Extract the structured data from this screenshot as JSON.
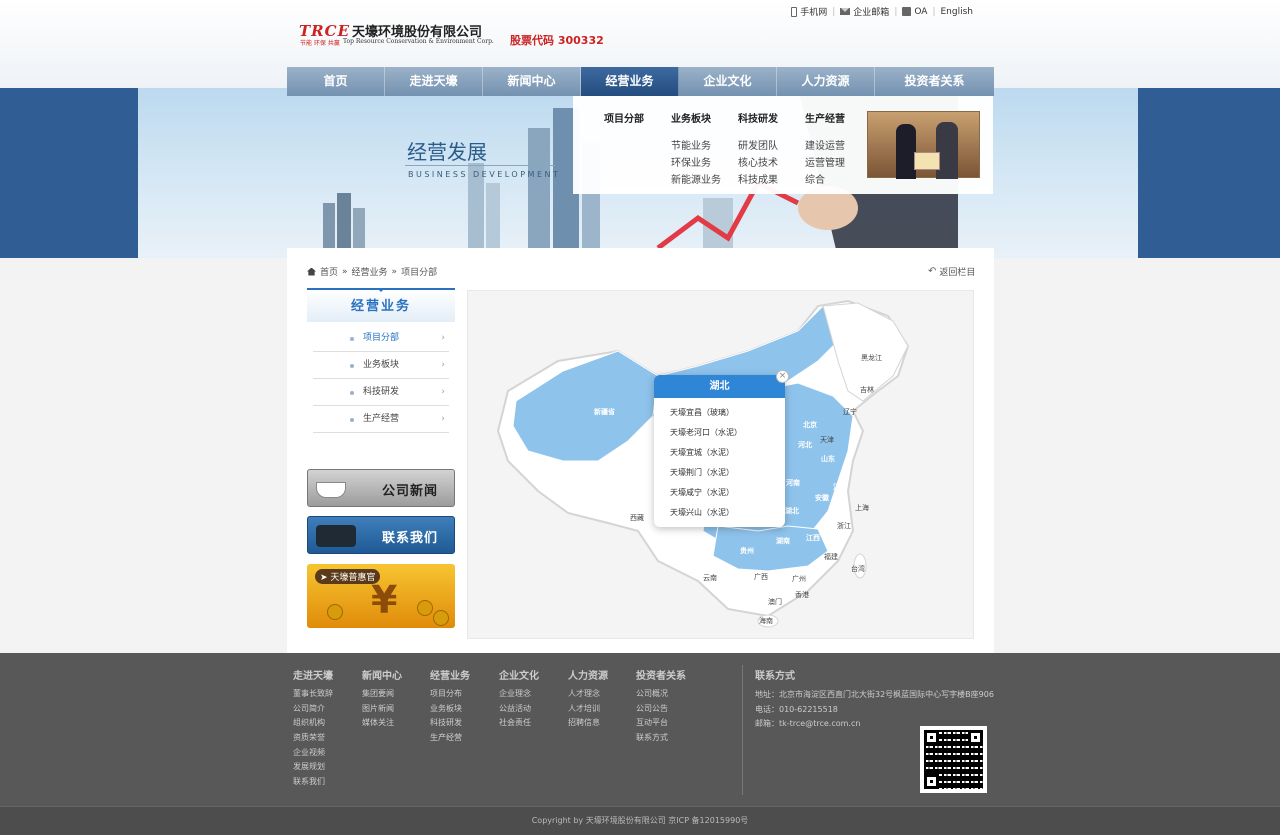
{
  "header": {
    "logo_mark": "TRCE",
    "company_name": "天壕环境股份有限公司",
    "slogan": "节能  环保  共赢",
    "english_name": "Top Resource Conservation & Environment Corp.",
    "stock_code": "股票代码 300332",
    "top_links": [
      "手机网",
      "企业邮箱",
      "OA",
      "English"
    ]
  },
  "nav": {
    "items": [
      "首页",
      "走进天壕",
      "新闻中心",
      "经营业务",
      "企业文化",
      "人力资源",
      "投资者关系"
    ],
    "active_index": 3
  },
  "dropdown": {
    "columns": [
      {
        "heading": "项目分部",
        "links": []
      },
      {
        "heading": "业务板块",
        "links": [
          "节能业务",
          "环保业务",
          "新能源业务"
        ]
      },
      {
        "heading": "科技研发",
        "links": [
          "研发团队",
          "核心技术",
          "科技成果"
        ]
      },
      {
        "heading": "生产经营",
        "links": [
          "建设运营",
          "运营管理",
          "综合"
        ]
      }
    ]
  },
  "banner": {
    "title": "经营发展",
    "subtitle": "BUSINESS DEVELOPMENT"
  },
  "breadcrumb": {
    "items": [
      "首页",
      "经营业务",
      "项目分部"
    ],
    "back": "返回栏目"
  },
  "sidebar": {
    "title": "经营业务",
    "items": [
      "项目分部",
      "业务板块",
      "科技研发",
      "生产经营"
    ],
    "active_index": 0
  },
  "promos": {
    "news": "公司新闻",
    "contact": "联系我们",
    "gift": "天壕普惠官"
  },
  "map": {
    "provinces_labels": [
      "新疆省",
      "西藏",
      "黑龙江",
      "吉林",
      "辽宁",
      "北京",
      "天津",
      "河北",
      "山东",
      "河南",
      "江苏",
      "安徽",
      "上海",
      "浙江",
      "湖北",
      "湖南",
      "江西",
      "贵州",
      "福建",
      "云南",
      "广西",
      "广州",
      "台湾",
      "香港",
      "澳门",
      "海南"
    ],
    "popup": {
      "title": "湖北",
      "items": [
        "天壕宜昌（玻璃）",
        "天壕老河口（水泥）",
        "天壕宜城（水泥）",
        "天壕荆门（水泥）",
        "天壕咸宁（水泥）",
        "天壕兴山（水泥）"
      ]
    },
    "highlight_color": "#8ec3ec",
    "base_color": "#ffffff"
  },
  "footer": {
    "columns": [
      {
        "heading": "走进天壕",
        "links": [
          "董事长致辞",
          "公司简介",
          "组织机构",
          "资质荣誉",
          "企业视频",
          "发展规划",
          "联系我们"
        ]
      },
      {
        "heading": "新闻中心",
        "links": [
          "集团要闻",
          "图片新闻",
          "媒体关注"
        ]
      },
      {
        "heading": "经营业务",
        "links": [
          "项目分布",
          "业务板块",
          "科技研发",
          "生产经营"
        ]
      },
      {
        "heading": "企业文化",
        "links": [
          "企业理念",
          "公益活动",
          "社会责任"
        ]
      },
      {
        "heading": "人力资源",
        "links": [
          "人才理念",
          "人才培训",
          "招聘信息"
        ]
      },
      {
        "heading": "投资者关系",
        "links": [
          "公司概况",
          "公司公告",
          "互动平台",
          "联系方式"
        ]
      }
    ],
    "contact": {
      "heading": "联系方式",
      "address": "地址：北京市海淀区西直门北大街32号枫蓝国际中心写字楼B座906",
      "phone": "电话：010-62215518",
      "email": "邮箱：tk-trce@trce.com.cn"
    },
    "copyright": "Copyright by 天壕环境股份有限公司 京ICP 备12015990号"
  }
}
